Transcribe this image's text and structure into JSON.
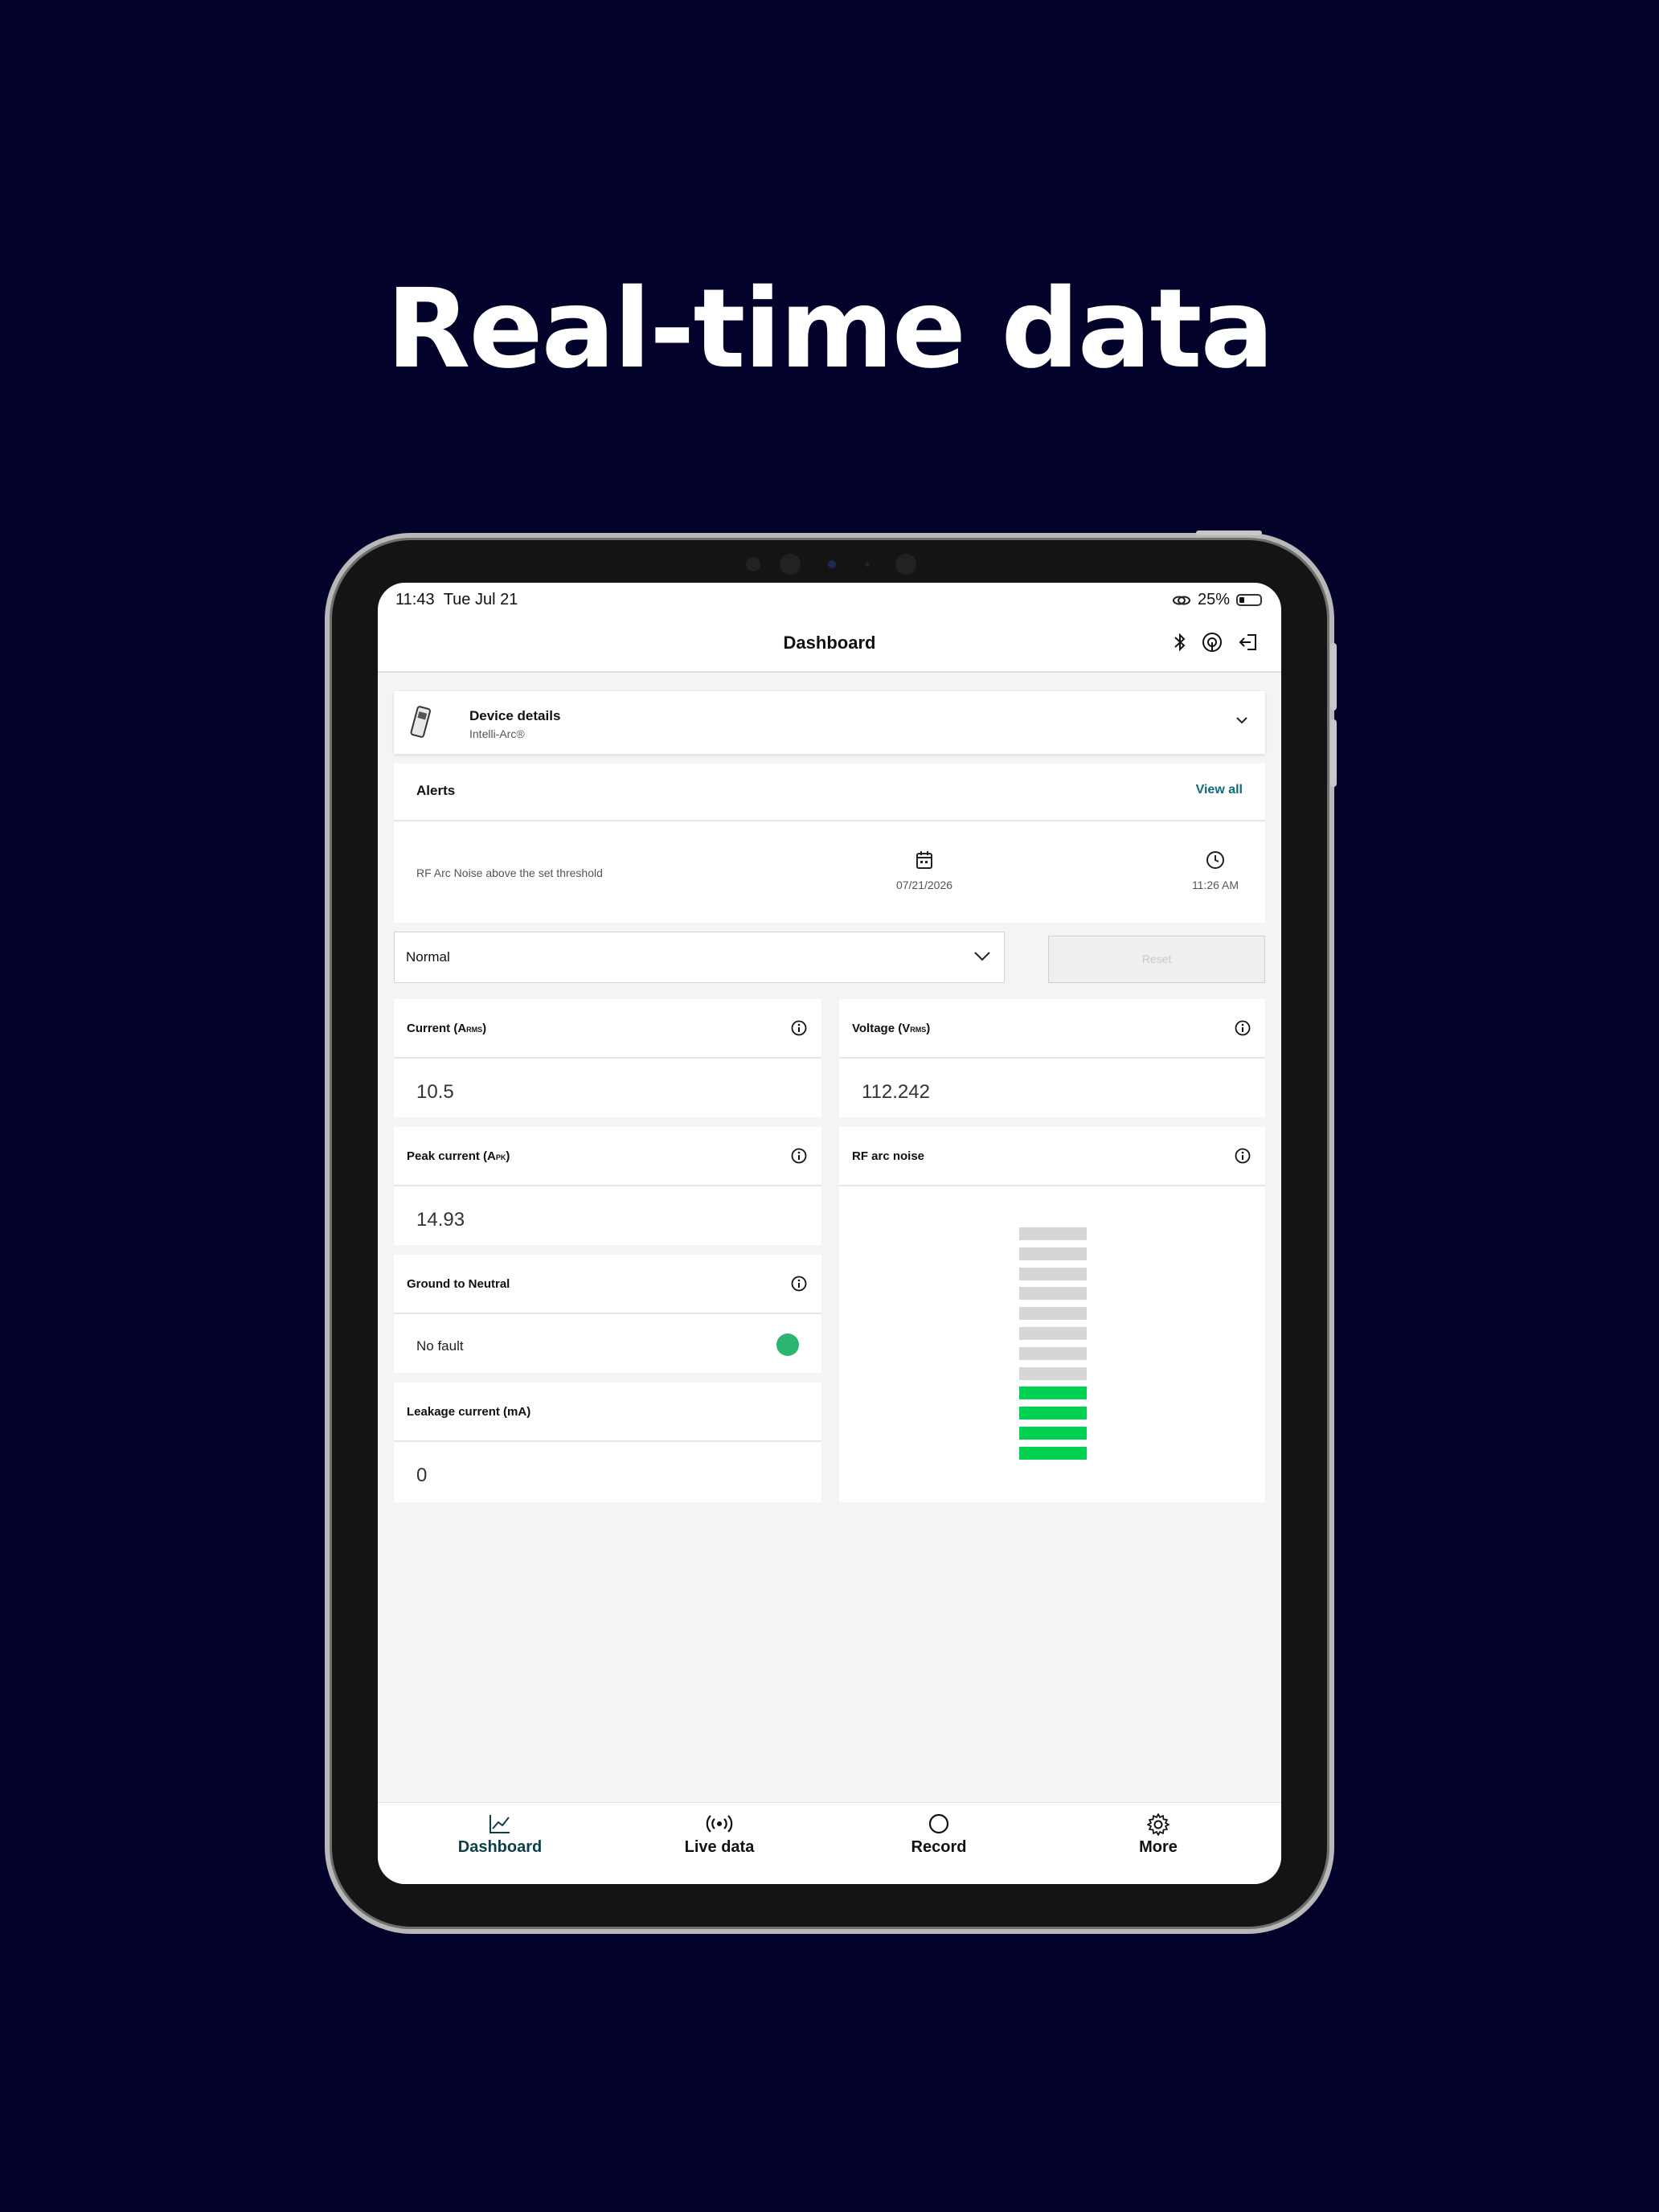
{
  "headline": "Real-time data",
  "status_bar": {
    "time": "11:43",
    "date": "Tue Jul 21",
    "battery": "25%"
  },
  "nav": {
    "title": "Dashboard"
  },
  "device": {
    "title": "Device details",
    "subtitle": "Intelli-Arc®"
  },
  "alerts": {
    "title": "Alerts",
    "view_all": "View all",
    "items": [
      {
        "message": "RF Arc Noise above the set threshold",
        "date": "07/21/2026",
        "time": "11:26 AM"
      }
    ]
  },
  "mode_select": {
    "value": "Normal"
  },
  "reset_label": "Reset",
  "metrics": {
    "current": {
      "title": "Current (A",
      "sub": "RMS",
      "close": ")",
      "value": "10.5"
    },
    "voltage": {
      "title": "Voltage (V",
      "sub": "RMS",
      "close": ")",
      "value": "112.242"
    },
    "peak": {
      "title": "Peak current (A",
      "sub": "PK",
      "close": ")",
      "value": "14.93"
    },
    "ground": {
      "title": "Ground to Neutral",
      "value": "No fault",
      "status_color": "#2cb56f"
    },
    "leakage": {
      "title": "Leakage current (mA)",
      "value": "0"
    },
    "rf": {
      "title": "RF arc noise",
      "total_segments": 12,
      "active_segments": 4,
      "active_color": "#00d150",
      "inactive_color": "#d6d6d6"
    }
  },
  "tabs": [
    {
      "label": "Dashboard",
      "icon": "chart-icon",
      "active": true
    },
    {
      "label": "Live data",
      "icon": "broadcast-icon",
      "active": false
    },
    {
      "label": "Record",
      "icon": "record-icon",
      "active": false
    },
    {
      "label": "More",
      "icon": "gear-icon",
      "active": false
    }
  ],
  "colors": {
    "background": "#03022a",
    "accent": "#0d6b7a"
  }
}
